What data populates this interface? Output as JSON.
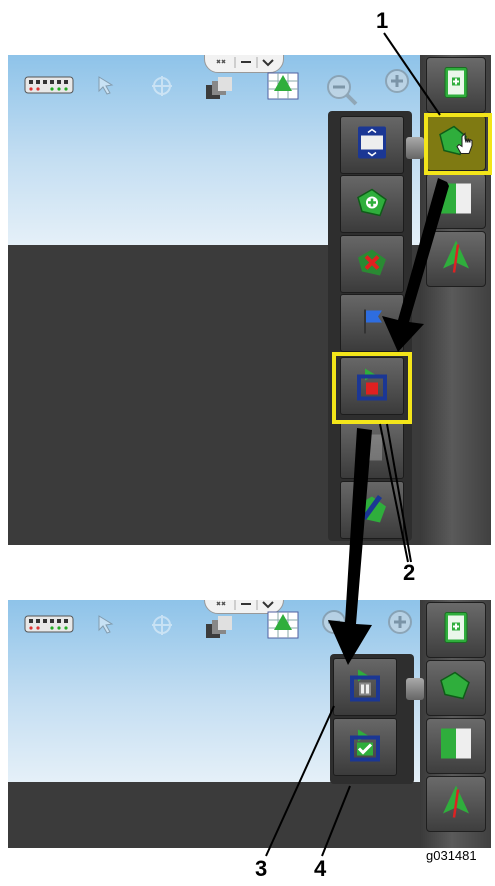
{
  "callouts": {
    "c1": "1",
    "c2": "2",
    "c3": "3",
    "c4": "4"
  },
  "figure_id": "g031481",
  "top_screen": {
    "toolbar_icons": [
      "implement-icon",
      "pointer-icon",
      "gps-icon",
      "layers-icon",
      "field-map-icon",
      "zoom-out-icon",
      "zoom-in-icon"
    ],
    "tab_icons": [
      "collapse-icon",
      "minus-icon",
      "chevron-down-icon"
    ],
    "right_rail": [
      "book-icon",
      "field-boundary-icon",
      "guidance-lines-icon",
      "ab-line-icon"
    ],
    "popup_menu": [
      "list-icon",
      "add-field-icon",
      "delete-field-icon",
      "flag-icon",
      "record-boundary-icon",
      "import-icon",
      "draw-icon"
    ]
  },
  "bottom_screen": {
    "popup_menu": [
      "pause-boundary-icon",
      "finish-boundary-icon"
    ],
    "right_rail": [
      "book-icon",
      "field-boundary-icon",
      "guidance-lines-icon",
      "ab-line-icon"
    ]
  },
  "colors": {
    "highlight": "#f3e51a",
    "sky": "#a9d1ee",
    "ground": "#3b3b3b",
    "green": "#2fae3c",
    "navy": "#1b3794"
  }
}
